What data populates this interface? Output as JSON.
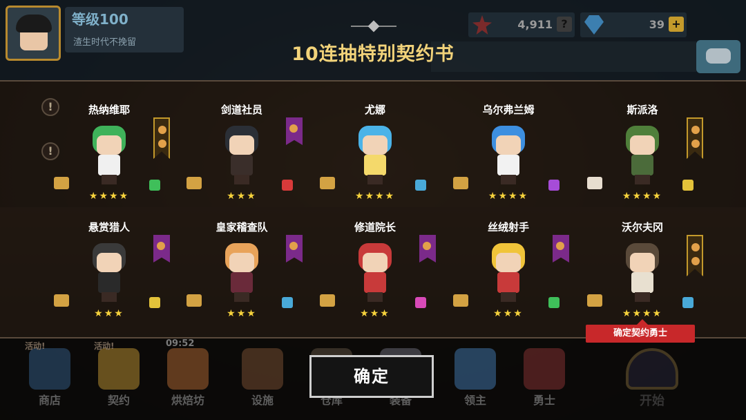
{
  "player": {
    "level_label": "等级100",
    "subtitle": "渣生时代不挽留"
  },
  "resources": {
    "stars_value": "4,911",
    "gems_value": "39"
  },
  "pack": {
    "title": "10连抽特别契约书"
  },
  "heroes": [
    {
      "name": "热纳维耶",
      "stars": "★★★★",
      "banner": "gold",
      "scroll": "gold",
      "class_color": "#3fbf5a",
      "colors": {
        "hair": "#3fb25a",
        "body": "#f0f0f0"
      }
    },
    {
      "name": "剑道社员",
      "stars": "★★★",
      "banner": "purple",
      "scroll": "gold",
      "class_color": "#d83a3a",
      "colors": {
        "hair": "#2b2f36",
        "body": "#3a2e2a"
      }
    },
    {
      "name": "尤娜",
      "stars": "★★★★",
      "banner": "none",
      "scroll": "gold",
      "class_color": "#49a9d8",
      "colors": {
        "hair": "#4bb3e8",
        "body": "#f4d96b"
      }
    },
    {
      "name": "乌尔弗兰姆",
      "stars": "★★★★",
      "banner": "none",
      "scroll": "gold",
      "class_color": "#a64cd8",
      "colors": {
        "hair": "#3d8fe0",
        "body": "#f2f2f2"
      }
    },
    {
      "name": "斯派洛",
      "stars": "★★★★",
      "banner": "gold",
      "scroll": "white",
      "class_color": "#e3c23a",
      "colors": {
        "hair": "#4f7f3a",
        "body": "#4b6b3a"
      }
    },
    {
      "name": "悬赏猎人",
      "stars": "★★★",
      "banner": "purple",
      "scroll": "gold",
      "class_color": "#e3c23a",
      "colors": {
        "hair": "#3a3a3a",
        "body": "#2a2a2a"
      }
    },
    {
      "name": "皇家稽查队",
      "stars": "★★★",
      "banner": "purple",
      "scroll": "gold",
      "class_color": "#49a9d8",
      "colors": {
        "hair": "#e8a35a",
        "body": "#6a2a3a"
      }
    },
    {
      "name": "修道院长",
      "stars": "★★★",
      "banner": "purple",
      "scroll": "gold",
      "class_color": "#d84ab8",
      "colors": {
        "hair": "#c83a3a",
        "body": "#c83a3a"
      }
    },
    {
      "name": "丝绒射手",
      "stars": "★★★",
      "banner": "purple",
      "scroll": "gold",
      "class_color": "#3fbf5a",
      "colors": {
        "hair": "#f0c43a",
        "body": "#c83a3a"
      }
    },
    {
      "name": "沃尔夫冈",
      "stars": "★★★★",
      "banner": "gold",
      "scroll": "gold",
      "class_color": "#49a9d8",
      "colors": {
        "hair": "#5a4a3a",
        "body": "#e8e0d0"
      }
    }
  ],
  "confirm": {
    "label": "确定",
    "tip": "确定契约勇士"
  },
  "nav": {
    "items": [
      {
        "label": "商店",
        "badge": "活动!",
        "color": "#3a6a9a"
      },
      {
        "label": "契约",
        "badge": "活动!",
        "color": "#d8a83a"
      },
      {
        "label": "烘焙坊",
        "badge": "09:52",
        "color": "#c8783a"
      },
      {
        "label": "设施",
        "badge": "",
        "color": "#8a5a3a"
      },
      {
        "label": "仓库",
        "badge": "",
        "color": "#6a5a4a"
      },
      {
        "label": "装备",
        "badge": "",
        "color": "#7a7a8a"
      },
      {
        "label": "领主",
        "badge": "",
        "color": "#4a8ac8"
      },
      {
        "label": "勇士",
        "badge": "",
        "color": "#9a3a3a"
      }
    ],
    "start_label": "开始"
  }
}
